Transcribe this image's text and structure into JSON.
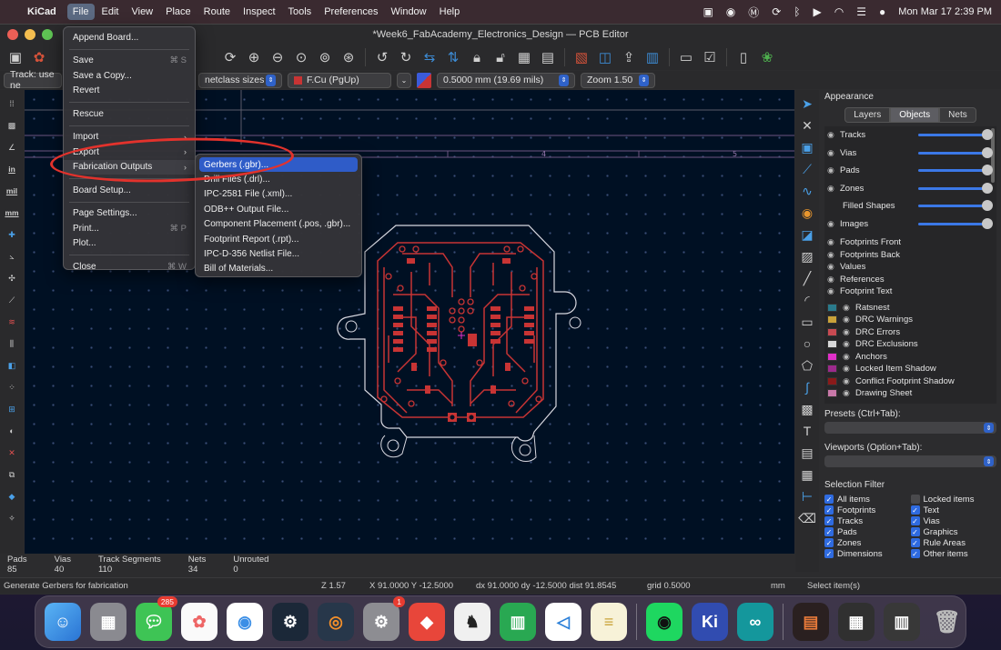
{
  "menubar": {
    "app_name": "KiCad",
    "items": [
      "File",
      "Edit",
      "View",
      "Place",
      "Route",
      "Inspect",
      "Tools",
      "Preferences",
      "Window",
      "Help"
    ],
    "clock": "Mon Mar 17  2:39 PM"
  },
  "window": {
    "title": "*Week6_FabAcademy_Electronics_Design — PCB Editor"
  },
  "toolbar2": {
    "track_combo": "Track: use ne",
    "netclass_combo": "netclass sizes",
    "layer_combo": "F.Cu (PgUp)",
    "via_combo": "0.5000 mm (19.69 mils)",
    "zoom_combo": "Zoom 1.50"
  },
  "left_toolbar": {
    "in_label": "in",
    "mil_label": "mil",
    "mm_label": "mm"
  },
  "canvas": {
    "ruler_labels": [
      "4",
      "5"
    ]
  },
  "file_menu": {
    "items": [
      {
        "label": "Append Board...",
        "shortcut": ""
      },
      {
        "label": "Save",
        "shortcut": "⌘ S"
      },
      {
        "label": "Save a Copy...",
        "shortcut": ""
      },
      {
        "label": "Revert",
        "shortcut": ""
      },
      {
        "label": "Rescue",
        "shortcut": ""
      },
      {
        "label": "Import",
        "shortcut": ""
      },
      {
        "label": "Export",
        "shortcut": ""
      },
      {
        "label": "Fabrication Outputs",
        "shortcut": ""
      },
      {
        "label": "Board Setup...",
        "shortcut": ""
      },
      {
        "label": "Page Settings...",
        "shortcut": ""
      },
      {
        "label": "Print...",
        "shortcut": "⌘ P"
      },
      {
        "label": "Plot...",
        "shortcut": ""
      },
      {
        "label": "Close",
        "shortcut": "⌘ W"
      }
    ]
  },
  "fab_submenu": {
    "items": [
      "Gerbers (.gbr)...",
      "Drill Files (.drl)...",
      "IPC-2581 File (.xml)...",
      "ODB++ Output File...",
      "Component Placement (.pos, .gbr)...",
      "Footprint Report (.rpt)...",
      "IPC-D-356 Netlist File...",
      "Bill of Materials..."
    ]
  },
  "appearance": {
    "title": "Appearance",
    "tabs": [
      "Layers",
      "Objects",
      "Nets"
    ],
    "objects": [
      {
        "label": "Tracks",
        "slider": true
      },
      {
        "label": "Vias",
        "slider": true
      },
      {
        "label": "Pads",
        "slider": true
      },
      {
        "label": "Zones",
        "slider": true
      },
      {
        "label": "Filled Shapes",
        "slider": true,
        "no_eye": true
      },
      {
        "label": "Images",
        "slider": true
      },
      {
        "label": "Footprints Front"
      },
      {
        "label": "Footprints Back"
      },
      {
        "label": "Values"
      },
      {
        "label": "References"
      },
      {
        "label": "Footprint Text"
      },
      {
        "label": "Ratsnest",
        "color": "#2a7a8c"
      },
      {
        "label": "DRC Warnings",
        "color": "#c9a23a"
      },
      {
        "label": "DRC Errors",
        "color": "#c84a52"
      },
      {
        "label": "DRC Exclusions",
        "color": "#d8d8d8"
      },
      {
        "label": "Anchors",
        "color": "#e030c8"
      },
      {
        "label": "Locked Item Shadow",
        "color": "#9c2a8c"
      },
      {
        "label": "Conflict Footprint Shadow",
        "color": "#8a1a1a"
      },
      {
        "label": "Drawing Sheet",
        "color": "#c878a8"
      }
    ],
    "presets_label": "Presets (Ctrl+Tab):",
    "viewports_label": "Viewports (Option+Tab):"
  },
  "selection_filter": {
    "title": "Selection Filter",
    "items": [
      {
        "label": "All items",
        "checked": true
      },
      {
        "label": "Locked items",
        "checked": false
      },
      {
        "label": "Footprints",
        "checked": true
      },
      {
        "label": "Text",
        "checked": true
      },
      {
        "label": "Tracks",
        "checked": true
      },
      {
        "label": "Vias",
        "checked": true
      },
      {
        "label": "Pads",
        "checked": true
      },
      {
        "label": "Graphics",
        "checked": true
      },
      {
        "label": "Zones",
        "checked": true
      },
      {
        "label": "Rule Areas",
        "checked": true
      },
      {
        "label": "Dimensions",
        "checked": true
      },
      {
        "label": "Other items",
        "checked": true
      }
    ]
  },
  "message_panel": [
    {
      "key": "Pads",
      "value": "85"
    },
    {
      "key": "Vias",
      "value": "40"
    },
    {
      "key": "Track Segments",
      "value": "110"
    },
    {
      "key": "Nets",
      "value": "34"
    },
    {
      "key": "Unrouted",
      "value": "0"
    }
  ],
  "statusbar": {
    "hint": "Generate Gerbers for fabrication",
    "zoom": "Z 1.57",
    "xy": "X 91.0000  Y -12.5000",
    "dxy": "dx 91.0000  dy -12.5000  dist 91.8545",
    "grid": "grid 0.5000",
    "units": "mm",
    "mode": "Select item(s)"
  },
  "dock": {
    "messages_badge": "285",
    "settings_badge": "1"
  },
  "colors": {
    "accent": "#2f5cc8",
    "annotation": "#e3322c",
    "copper": "#c83434",
    "canvas_bg": "#001023"
  }
}
